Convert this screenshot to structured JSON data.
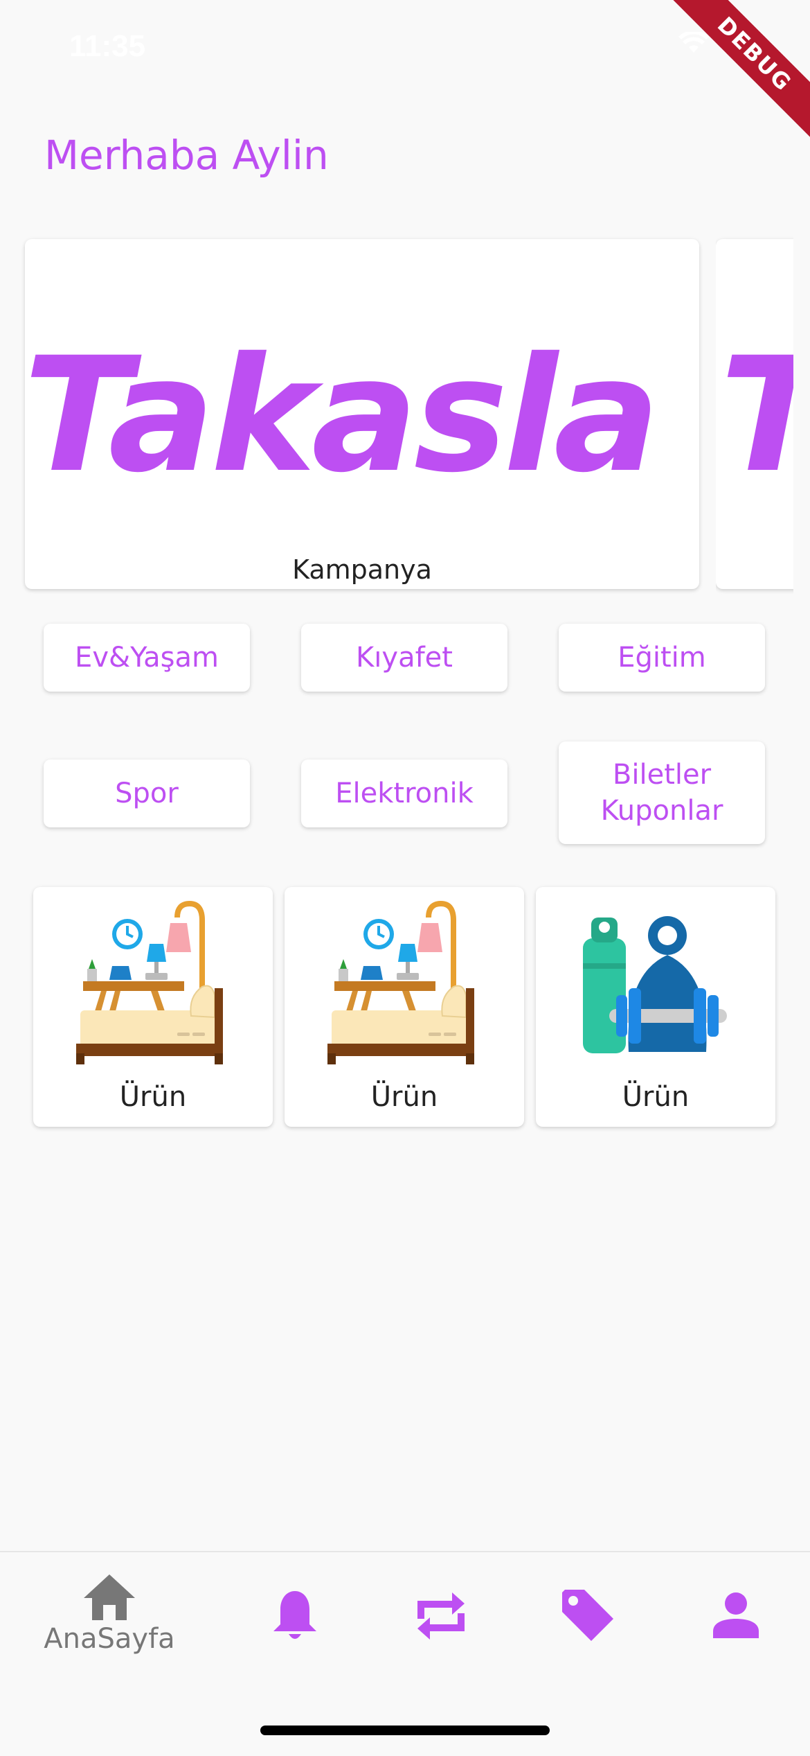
{
  "status_bar": {
    "time": "11:35"
  },
  "debug_banner": {
    "label": "DEBUG"
  },
  "greeting": "Merhaba Aylin",
  "banner": {
    "logo_text": "Takasla",
    "peek_text": "T",
    "caption": "Kampanya"
  },
  "categories": [
    {
      "label": "Ev&Yaşam"
    },
    {
      "label": "Kıyafet"
    },
    {
      "label": "Eğitim"
    },
    {
      "label": "Spor"
    },
    {
      "label": "Elektronik"
    },
    {
      "label": "Biletler\nKuponlar"
    }
  ],
  "products": [
    {
      "label": "Ürün",
      "icon": "bedroom-icon"
    },
    {
      "label": "Ürün",
      "icon": "bedroom-icon"
    },
    {
      "label": "Ürün",
      "icon": "fitness-icon"
    }
  ],
  "bottom_nav": {
    "items": [
      {
        "label": "AnaSayfa",
        "icon": "home-icon",
        "active": true
      },
      {
        "label": "",
        "icon": "bell-icon"
      },
      {
        "label": "",
        "icon": "swap-icon"
      },
      {
        "label": "",
        "icon": "tag-icon"
      },
      {
        "label": "",
        "icon": "person-icon"
      }
    ]
  },
  "colors": {
    "accent": "#bd4ff2",
    "nav_inactive": "#777777",
    "background": "#f9f9f9"
  }
}
